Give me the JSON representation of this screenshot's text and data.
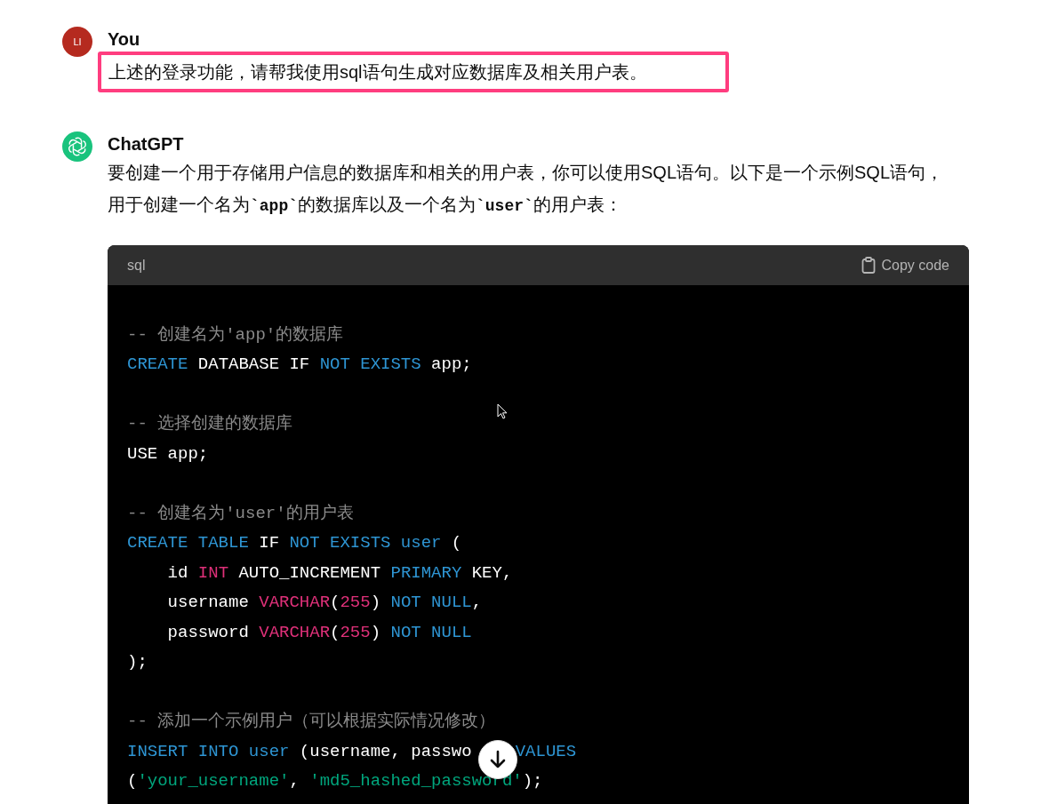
{
  "messages": [
    {
      "kind": "user",
      "author": "You",
      "avatar": "LI",
      "highlighted": true,
      "segments": [
        {
          "t": "上述的登录功能，请帮我使用sql语句生成对应数据库及相关用户表。",
          "code": false
        }
      ]
    },
    {
      "kind": "assistant",
      "author": "ChatGPT",
      "segments": [
        {
          "t": "要创建一个用于存储用户信息的数据库和相关的用户表，你可以使用SQL语句。以下是一个示例SQL语句，用于创建一个名为",
          "code": false
        },
        {
          "t": "`app`",
          "code": true
        },
        {
          "t": "的数据库以及一个名为",
          "code": false
        },
        {
          "t": "`user`",
          "code": true
        },
        {
          "t": "的用户表：",
          "code": false
        }
      ],
      "code_block": {
        "language": "sql",
        "copy_label": "Copy code",
        "lines": [
          {
            "tokens": [
              {
                "t": "-- 创建名为'app'的数据库",
                "kind": "comment"
              }
            ]
          },
          {
            "tokens": [
              {
                "t": "CREATE",
                "kind": "kw"
              },
              {
                "t": " DATABASE IF ",
                "kind": "plain"
              },
              {
                "t": "NOT EXISTS",
                "kind": "kw"
              },
              {
                "t": " app;",
                "kind": "plain"
              }
            ]
          },
          {
            "gap_before": true,
            "tokens": [
              {
                "t": "-- 选择创建的数据库",
                "kind": "comment"
              }
            ]
          },
          {
            "tokens": [
              {
                "t": "USE app;",
                "kind": "plain"
              }
            ]
          },
          {
            "gap_before": true,
            "tokens": [
              {
                "t": "-- 创建名为'user'的用户表",
                "kind": "comment"
              }
            ]
          },
          {
            "tokens": [
              {
                "t": "CREATE TABLE",
                "kind": "kw"
              },
              {
                "t": " IF ",
                "kind": "plain"
              },
              {
                "t": "NOT EXISTS user",
                "kind": "kw"
              },
              {
                "t": " (",
                "kind": "plain"
              }
            ]
          },
          {
            "tokens": [
              {
                "t": "    id ",
                "kind": "plain"
              },
              {
                "t": "INT",
                "kind": "type"
              },
              {
                "t": " AUTO_INCREMENT ",
                "kind": "plain"
              },
              {
                "t": "PRIMARY",
                "kind": "kw"
              },
              {
                "t": " KEY,",
                "kind": "plain"
              }
            ]
          },
          {
            "tokens": [
              {
                "t": "    username ",
                "kind": "plain"
              },
              {
                "t": "VARCHAR",
                "kind": "type"
              },
              {
                "t": "(",
                "kind": "plain"
              },
              {
                "t": "255",
                "kind": "type"
              },
              {
                "t": ") ",
                "kind": "plain"
              },
              {
                "t": "NOT NULL",
                "kind": "kw"
              },
              {
                "t": ",",
                "kind": "plain"
              }
            ]
          },
          {
            "tokens": [
              {
                "t": "    password ",
                "kind": "plain"
              },
              {
                "t": "VARCHAR",
                "kind": "type"
              },
              {
                "t": "(",
                "kind": "plain"
              },
              {
                "t": "255",
                "kind": "type"
              },
              {
                "t": ") ",
                "kind": "plain"
              },
              {
                "t": "NOT NULL",
                "kind": "kw"
              }
            ]
          },
          {
            "tokens": [
              {
                "t": ");",
                "kind": "plain"
              }
            ]
          },
          {
            "gap_before": true,
            "tokens": [
              {
                "t": "-- 添加一个示例用户（可以根据实际情况修改）",
                "kind": "comment"
              }
            ]
          },
          {
            "tokens": [
              {
                "t": "INSERT INTO user",
                "kind": "kw"
              },
              {
                "t": " (username, passwo",
                "kind": "plain"
              },
              {
                "t": "VALUES",
                "kind": "kw",
                "covered_before": true
              }
            ]
          },
          {
            "tokens": [
              {
                "t": "(",
                "kind": "plain"
              },
              {
                "t": "'your_username'",
                "kind": "str"
              },
              {
                "t": ", ",
                "kind": "plain"
              },
              {
                "t": "'md5_hashed_password'",
                "kind": "str"
              },
              {
                "t": ");",
                "kind": "plain"
              }
            ]
          }
        ]
      }
    }
  ]
}
